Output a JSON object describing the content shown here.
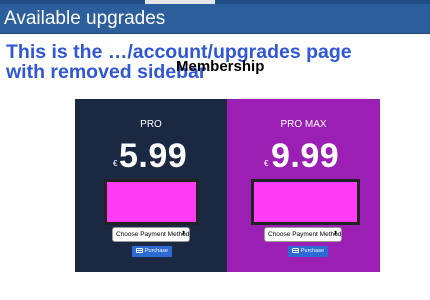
{
  "header": {
    "title": "Available upgrades"
  },
  "annotation": {
    "line1": "This is the …/account/upgrades  page",
    "line2": "with removed sidebar"
  },
  "section_title": "Membership",
  "plans": [
    {
      "name": "PRO",
      "currency": "€",
      "price": "5.99",
      "payment_select": "Choose Payment Method",
      "purchase_label": "Purchase",
      "card_color": "#1b2842"
    },
    {
      "name": "PRO MAX",
      "currency": "€",
      "price": "9.99",
      "payment_select": "Choose Payment Method",
      "purchase_label": "Purchase",
      "card_color": "#9c1fb4"
    }
  ],
  "colors": {
    "header": "#2b5e9a",
    "annotation": "#2f57d6",
    "redaction": "#ff3cf3",
    "button": "#2d6bd4"
  },
  "icons": {
    "purchase": "credit-card-icon",
    "select_caret": "select-caret-icon"
  }
}
